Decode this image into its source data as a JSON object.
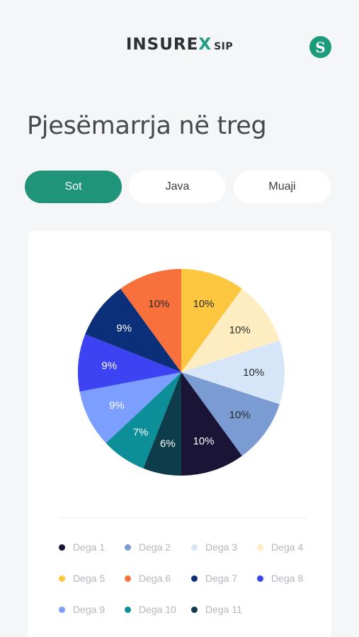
{
  "header": {
    "brand": "INSURE",
    "brand_accent": "X",
    "brand_suffix": "SIP",
    "avatar_letter": "S"
  },
  "page": {
    "title": "Pjesëmarrja në treg"
  },
  "tabs": [
    {
      "label": "Sot",
      "active": true
    },
    {
      "label": "Java",
      "active": false
    },
    {
      "label": "Muaji",
      "active": false
    }
  ],
  "colors": {
    "accent": "#1f9478",
    "background": "#f5f6f8"
  },
  "chart_data": {
    "type": "pie",
    "categories": [
      "Dega 1",
      "Dega 2",
      "Dega 3",
      "Dega 4",
      "Dega 5",
      "Dega 6",
      "Dega 7",
      "Dega 8",
      "Dega 9",
      "Dega 10",
      "Dega 11"
    ],
    "values": [
      10,
      10,
      10,
      10,
      10,
      10,
      9,
      9,
      9,
      7,
      6
    ],
    "labels": [
      "10%",
      "10%",
      "10%",
      "10%",
      "10%",
      "10%",
      "9%",
      "9%",
      "9%",
      "7%",
      "6%"
    ],
    "colors": [
      "#1a1537",
      "#7a9cd3",
      "#d7e5f8",
      "#fdedc0",
      "#fdc63f",
      "#f8703c",
      "#0b2f78",
      "#3d43f2",
      "#7c9eff",
      "#0c8f99",
      "#0d3c4b"
    ],
    "label_colors": [
      "#ffffff",
      "#2b2b2b",
      "#2b2b2b",
      "#2b2b2b",
      "#2b2b2b",
      "#2b2b2b",
      "#ffffff",
      "#ffffff",
      "#ffffff",
      "#ffffff",
      "#ffffff"
    ],
    "slice_order": [
      4,
      3,
      2,
      1,
      0,
      10,
      9,
      8,
      7,
      6,
      5
    ],
    "start_angle_deg": 0,
    "legend_position": "bottom"
  }
}
